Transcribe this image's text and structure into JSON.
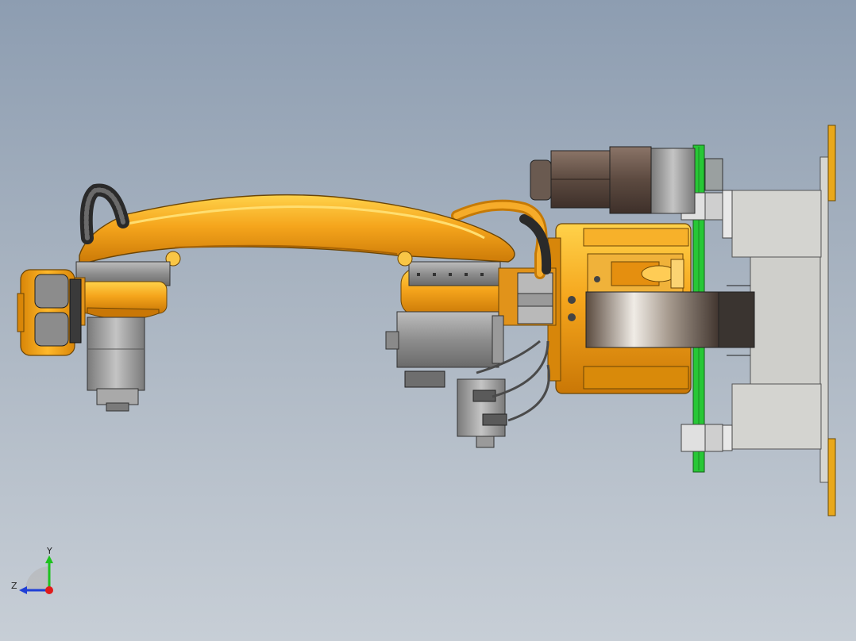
{
  "viewport": {
    "background_top": "#8d9db1",
    "background_bottom": "#c7ced6"
  },
  "model": {
    "colors": {
      "robot_orange": "#f2a21a",
      "robot_orange_dark": "#c97a08",
      "motor_grey": "#8e8e8e",
      "motor_dark": "#5b4a42",
      "green_plate": "#27c736",
      "base_plate": "#d4d4d0",
      "yellow_rail": "#e9a81b"
    }
  },
  "triad": {
    "y_label": "Y",
    "z_label": "Z",
    "y_color": "#1ec21e",
    "z_color": "#1f3fd6",
    "x_color": "#e01b1b"
  }
}
